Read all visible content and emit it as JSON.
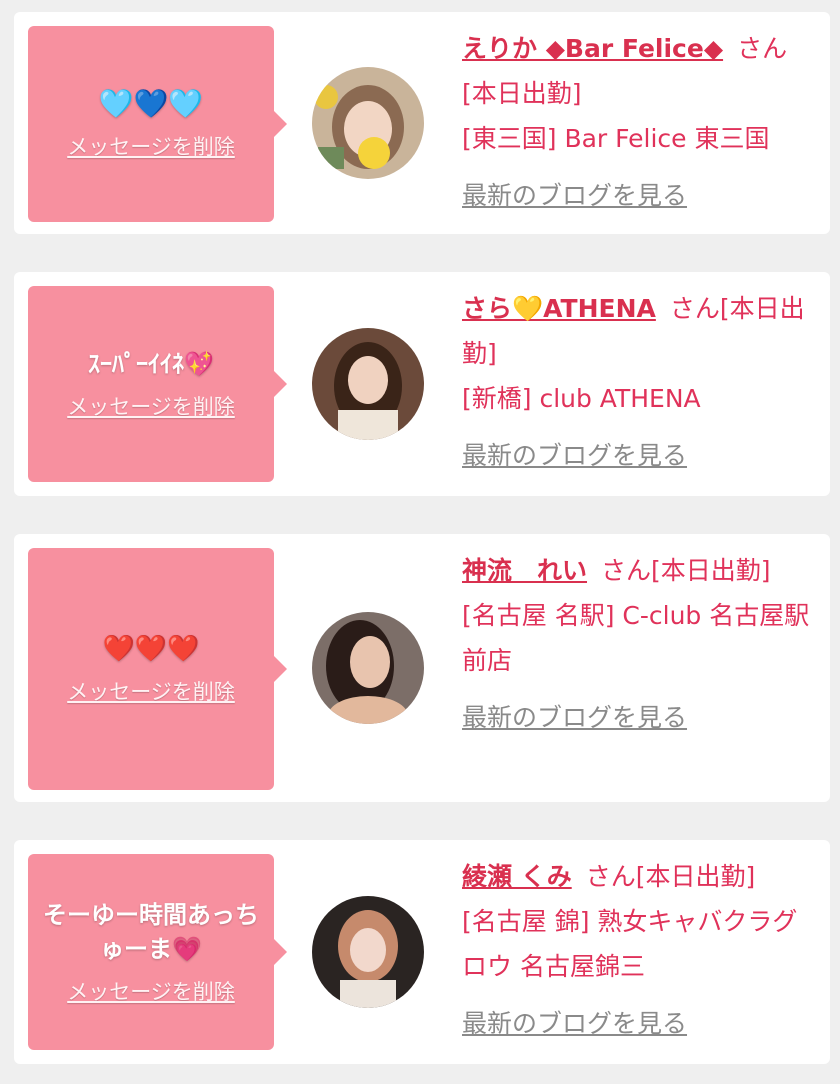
{
  "accent_color": "#e0325a",
  "bubble_color": "#f7909f",
  "entries": [
    {
      "message": "🩵💙🩵",
      "delete_label": "メッセージを削除",
      "name_prefix": "えりか ◆Bar Felice◆",
      "honorific_status": "さん[本日出勤]",
      "store": "[東三国] Bar Felice 東三国",
      "blog_label": "最新のブログを見る",
      "avatar_icon": "profile-photo-avatar"
    },
    {
      "message": "ｽｰﾊﾟｰｲｲﾈ💖",
      "delete_label": "メッセージを削除",
      "name_prefix": "さら💛ATHENA",
      "honorific_status": "さん[本日出勤]",
      "store": "[新橋] club ATHENA",
      "blog_label": "最新のブログを見る",
      "avatar_icon": "profile-photo-avatar"
    },
    {
      "message": "❤️❤️❤️",
      "delete_label": "メッセージを削除",
      "name_prefix": "神流　れい",
      "honorific_status": "さん[本日出勤]",
      "store": "[名古屋 名駅] C-club 名古屋駅前店",
      "blog_label": "最新のブログを見る",
      "avatar_icon": "profile-photo-avatar"
    },
    {
      "message": "そーゆー時間あっちゅーま💗",
      "delete_label": "メッセージを削除",
      "name_prefix": "綾瀬 くみ",
      "honorific_status": "さん[本日出勤]",
      "store": "[名古屋 錦] 熟女キャバクラグロウ 名古屋錦三",
      "blog_label": "最新のブログを見る",
      "avatar_icon": "profile-photo-avatar"
    }
  ]
}
